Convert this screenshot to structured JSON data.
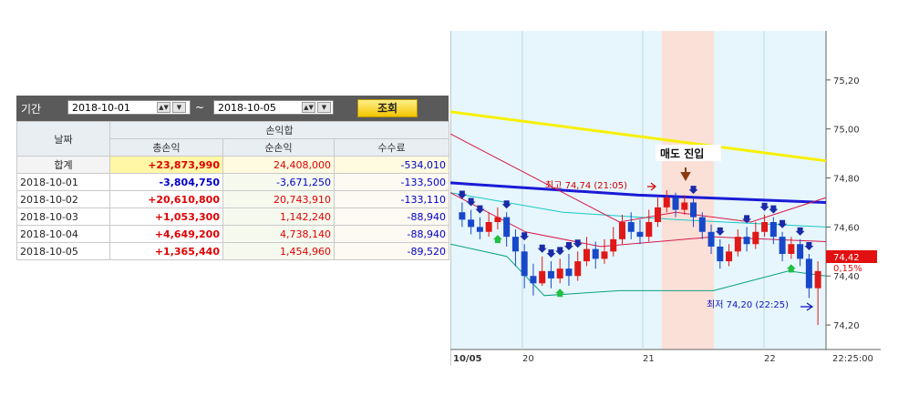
{
  "filter": {
    "label": "기간",
    "start_date": "2018-10-01",
    "end_date": "2018-10-05",
    "separator": "~",
    "query_button": "조회"
  },
  "table": {
    "header_date": "날짜",
    "header_group": "손익합",
    "columns": [
      "총손익",
      "순손익",
      "수수료"
    ],
    "total_label": "합계",
    "total": [
      "+23,873,990",
      "24,408,000",
      "-534,010"
    ],
    "rows": [
      {
        "date": "2018-10-01",
        "values": [
          "-3,804,750",
          "-3,671,250",
          "-133,500"
        ]
      },
      {
        "date": "2018-10-02",
        "values": [
          "+20,610,800",
          "20,743,910",
          "-133,110"
        ]
      },
      {
        "date": "2018-10-03",
        "values": [
          "+1,053,300",
          "1,142,240",
          "-88,940"
        ]
      },
      {
        "date": "2018-10-04",
        "values": [
          "+4,649,200",
          "4,738,140",
          "-88,940"
        ]
      },
      {
        "date": "2018-10-05",
        "values": [
          "+1,365,440",
          "1,454,960",
          "-89,520"
        ]
      }
    ]
  },
  "chart_data": {
    "type": "candlestick",
    "y_ticks": [
      "74,20",
      "74,40",
      "74,60",
      "74,80",
      "75,00",
      "75,20"
    ],
    "y_range": [
      74.1,
      75.4
    ],
    "x_labels": [
      "10/05",
      "20",
      "21",
      "22",
      "22:25:00"
    ],
    "current_price": "74,42",
    "current_change": "0,15%",
    "annotation_sell": "매도 진입",
    "annotation_high": "최고 74,74 (21:05)",
    "annotation_low": "최저 74,20 (22:25)",
    "candles": [
      [
        74.66,
        74.63,
        74.7,
        74.6
      ],
      [
        74.63,
        74.6,
        74.67,
        74.57
      ],
      [
        74.6,
        74.58,
        74.64,
        74.55
      ],
      [
        74.58,
        74.62,
        74.66,
        74.56
      ],
      [
        74.62,
        74.64,
        74.68,
        74.59
      ],
      [
        74.64,
        74.56,
        74.66,
        74.52
      ],
      [
        74.56,
        74.5,
        74.59,
        74.44
      ],
      [
        74.5,
        74.4,
        74.53,
        74.35
      ],
      [
        74.4,
        74.37,
        74.45,
        74.32
      ],
      [
        74.37,
        74.42,
        74.48,
        74.36
      ],
      [
        74.42,
        74.39,
        74.46,
        74.35
      ],
      [
        74.39,
        74.43,
        74.47,
        74.37
      ],
      [
        74.43,
        74.4,
        74.49,
        74.36
      ],
      [
        74.4,
        74.46,
        74.5,
        74.38
      ],
      [
        74.46,
        74.51,
        74.56,
        74.44
      ],
      [
        74.51,
        74.47,
        74.54,
        74.43
      ],
      [
        74.47,
        74.5,
        74.55,
        74.45
      ],
      [
        74.5,
        74.55,
        74.6,
        74.48
      ],
      [
        74.55,
        74.62,
        74.65,
        74.53
      ],
      [
        74.62,
        74.58,
        74.66,
        74.55
      ],
      [
        74.58,
        74.56,
        74.63,
        74.53
      ],
      [
        74.56,
        74.62,
        74.67,
        74.54
      ],
      [
        74.62,
        74.68,
        74.72,
        74.6
      ],
      [
        74.68,
        74.72,
        74.75,
        74.66
      ],
      [
        74.72,
        74.67,
        74.74,
        74.64
      ],
      [
        74.67,
        74.7,
        74.73,
        74.65
      ],
      [
        74.7,
        74.64,
        74.72,
        74.6
      ],
      [
        74.64,
        74.58,
        74.66,
        74.55
      ],
      [
        74.58,
        74.52,
        74.61,
        74.49
      ],
      [
        74.52,
        74.46,
        74.55,
        74.43
      ],
      [
        74.46,
        74.5,
        74.53,
        74.44
      ],
      [
        74.5,
        74.56,
        74.59,
        74.48
      ],
      [
        74.56,
        74.53,
        74.6,
        74.5
      ],
      [
        74.53,
        74.58,
        74.62,
        74.51
      ],
      [
        74.58,
        74.62,
        74.65,
        74.56
      ],
      [
        74.62,
        74.56,
        74.64,
        74.53
      ],
      [
        74.56,
        74.49,
        74.58,
        74.46
      ],
      [
        74.49,
        74.53,
        74.56,
        74.47
      ],
      [
        74.53,
        74.47,
        74.55,
        74.44
      ],
      [
        74.47,
        74.35,
        74.49,
        74.31
      ],
      [
        74.35,
        74.42,
        74.46,
        74.2
      ]
    ],
    "series": [
      {
        "name": "",
        "color": "#f7f000",
        "values": [
          [
            0,
            75.07
          ],
          [
            1,
            74.87
          ]
        ]
      },
      {
        "name": "",
        "color": "#1a1ad6",
        "values": [
          [
            0,
            74.78
          ],
          [
            0.5,
            74.73
          ],
          [
            1,
            74.7
          ]
        ]
      },
      {
        "name": "",
        "color": "#18c8c8",
        "values": [
          [
            0,
            74.74
          ],
          [
            0.3,
            74.66
          ],
          [
            0.6,
            74.63
          ],
          [
            1,
            74.6
          ]
        ]
      },
      {
        "name": "",
        "color": "#d8184a",
        "values": [
          [
            0,
            74.98
          ],
          [
            0.25,
            74.78
          ],
          [
            0.45,
            74.62
          ],
          [
            0.6,
            74.66
          ],
          [
            0.8,
            74.62
          ],
          [
            1,
            74.72
          ]
        ]
      },
      {
        "name": "",
        "color": "#d8184a",
        "values": [
          [
            0,
            74.74
          ],
          [
            0.2,
            74.58
          ],
          [
            0.4,
            74.52
          ],
          [
            0.7,
            74.56
          ],
          [
            1,
            74.54
          ]
        ]
      },
      {
        "name": "",
        "color": "#0aa080",
        "values": [
          [
            0,
            74.53
          ],
          [
            0.15,
            74.48
          ],
          [
            0.25,
            74.32
          ],
          [
            0.45,
            74.34
          ],
          [
            0.7,
            74.34
          ],
          [
            0.9,
            74.42
          ],
          [
            1,
            74.4
          ]
        ]
      }
    ]
  }
}
